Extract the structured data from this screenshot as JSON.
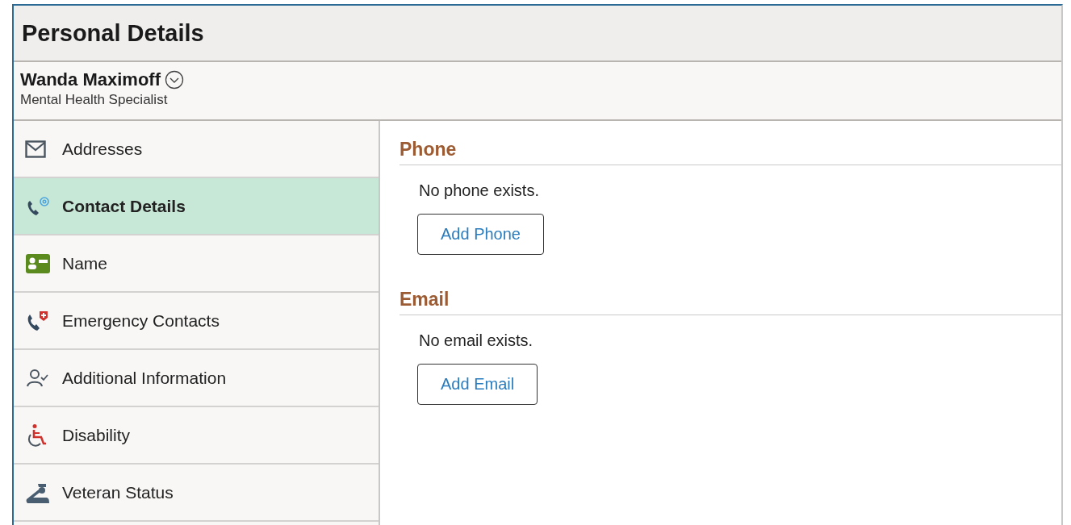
{
  "page_title": "Personal Details",
  "person": {
    "name": "Wanda Maximoff",
    "job_title": "Mental Health Specialist"
  },
  "sidebar": {
    "items": [
      {
        "label": "Addresses",
        "selected": false
      },
      {
        "label": "Contact Details",
        "selected": true
      },
      {
        "label": "Name",
        "selected": false
      },
      {
        "label": "Emergency Contacts",
        "selected": false
      },
      {
        "label": "Additional Information",
        "selected": false
      },
      {
        "label": "Disability",
        "selected": false
      },
      {
        "label": "Veteran Status",
        "selected": false
      }
    ]
  },
  "sections": [
    {
      "heading": "Phone",
      "message": "No phone exists.",
      "button": "Add Phone"
    },
    {
      "heading": "Email",
      "message": "No email exists.",
      "button": "Add Email"
    }
  ]
}
